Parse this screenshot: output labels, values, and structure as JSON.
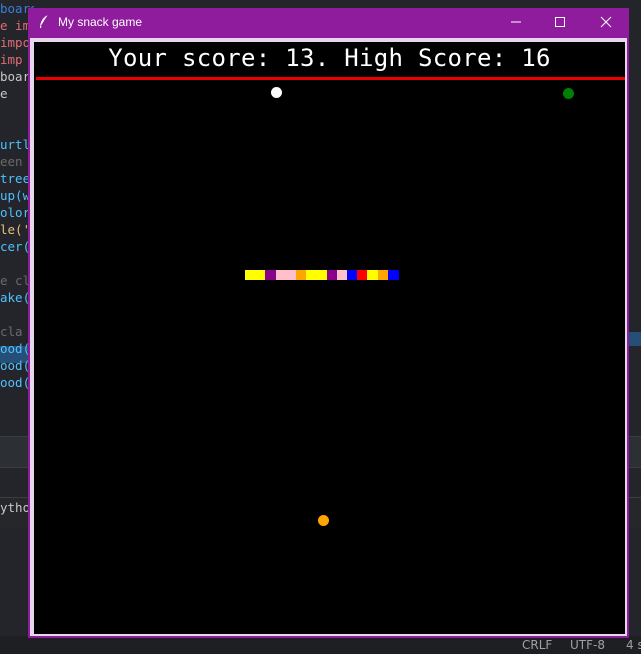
{
  "window": {
    "title": "My snack game",
    "title_bar_color": "#8e1c9c",
    "icon": "feather-icon",
    "buttons": {
      "minimize": "minimize-icon",
      "maximize": "maximize-icon",
      "close": "close-icon"
    }
  },
  "game": {
    "scoreboard": "Your score: 13. High Score: 16",
    "score": 13,
    "high_score": 16,
    "background_color": "#000000",
    "boundary_color": "#ea0000",
    "food": [
      {
        "color": "#ffffff"
      },
      {
        "color": "#008000"
      },
      {
        "color": "#ffa500"
      }
    ],
    "snake_segments": [
      "#ffff00",
      "#ffff00",
      "#8b008b",
      "#ffc0cb",
      "#ffc0cb",
      "#ffa500",
      "#ffff00",
      "#ffff00",
      "#8b008b",
      "#ffc0cb",
      "#0000ff",
      "#ff0000",
      "#ffff00",
      "#ffa500",
      "#0000ff"
    ]
  },
  "background_editor": {
    "code_fragments": [
      {
        "text": "board.py",
        "color": "#3c7dd9"
      },
      {
        "text": "e im",
        "color": "#e06c75"
      },
      {
        "text": "impo",
        "color": "#e06c75"
      },
      {
        "text": " imp",
        "color": "#e06c75"
      },
      {
        "text": "boar",
        "color": "#c8c8c8"
      },
      {
        "text": "e",
        "color": "#c8c8c8"
      },
      {
        "text": "",
        "color": "#c8c8c8"
      },
      {
        "text": "",
        "color": "#c8c8c8"
      },
      {
        "text": "urtl",
        "color": "#4fc1ff"
      },
      {
        "text": "een",
        "color": "#6a6a6a"
      },
      {
        "text": "tree",
        "color": "#4fc1ff"
      },
      {
        "text": "up(w",
        "color": "#4fc1ff"
      },
      {
        "text": "olor",
        "color": "#4fc1ff"
      },
      {
        "text": "le('",
        "color": "#e5c07b"
      },
      {
        "text": "cer(",
        "color": "#4fc1ff"
      },
      {
        "text": "",
        "color": "#c8c8c8"
      },
      {
        "text": "e cl",
        "color": "#6a6a6a"
      },
      {
        "text": "ake(",
        "color": "#4fc1ff"
      },
      {
        "text": "",
        "color": "#c8c8c8"
      },
      {
        "text": "cla",
        "color": "#6a6a6a"
      },
      {
        "text": "ood(",
        "color": "#4fc1ff"
      },
      {
        "text": "ood(",
        "color": "#4fc1ff"
      },
      {
        "text": "ood(",
        "color": "#4fc1ff"
      }
    ],
    "terminal_fragment": "ytho",
    "status_bar": {
      "line_ending": "CRLF",
      "encoding": "UTF-8",
      "indent": "4 s"
    }
  }
}
